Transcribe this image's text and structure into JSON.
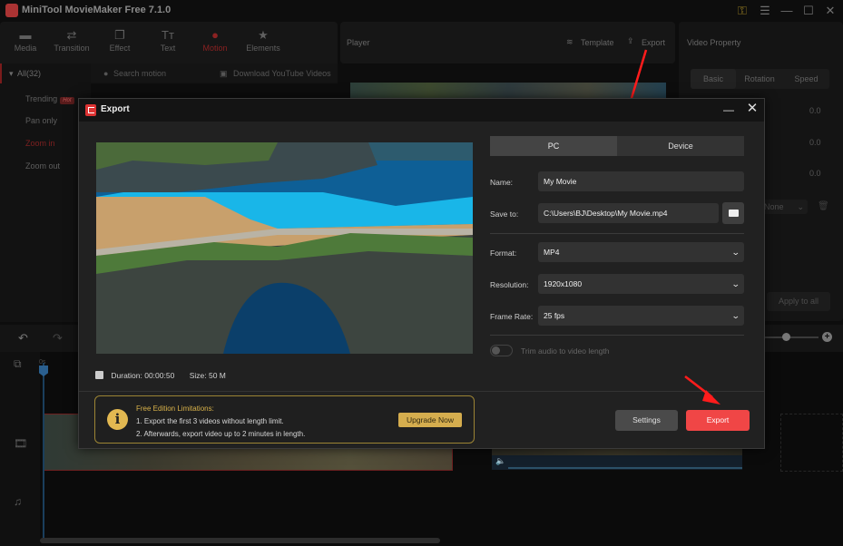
{
  "app": {
    "title": "MiniTool MovieMaker Free 7.1.0",
    "window_controls": [
      "key-icon",
      "menu-icon",
      "minimize-icon",
      "maximize-icon",
      "close-icon"
    ]
  },
  "toolbar": {
    "tabs": [
      {
        "label": "Media",
        "icon": "folder-icon",
        "active": false
      },
      {
        "label": "Transition",
        "icon": "swap-icon",
        "active": false
      },
      {
        "label": "Effect",
        "icon": "layers-icon",
        "active": false
      },
      {
        "label": "Text",
        "icon": "text-icon",
        "active": false
      },
      {
        "label": "Motion",
        "icon": "motion-icon",
        "active": true
      },
      {
        "label": "Elements",
        "icon": "elements-icon",
        "active": false
      }
    ]
  },
  "library": {
    "category_all": "All(32)",
    "search_placeholder": "Search motion",
    "download_label": "Download YouTube Videos",
    "items": [
      {
        "label": "Trending",
        "badge": "Hot",
        "active": false
      },
      {
        "label": "Pan only",
        "active": false
      },
      {
        "label": "Zoom in",
        "active": true
      },
      {
        "label": "Zoom out",
        "active": false
      }
    ]
  },
  "player": {
    "title": "Player",
    "template_label": "Template",
    "export_label": "Export"
  },
  "property": {
    "title": "Video Property",
    "tabs": [
      {
        "label": "Basic",
        "active": true
      },
      {
        "label": "Rotation",
        "active": false
      },
      {
        "label": "Speed",
        "active": false
      }
    ],
    "values": [
      "0.0",
      "0.0",
      "0.0"
    ],
    "select_value": "None",
    "apply_all_label": "Apply to all"
  },
  "timeline": {
    "time_zero": "0s",
    "zoom_level": 0.4
  },
  "dialog": {
    "title": "Export",
    "tabs": [
      {
        "label": "PC",
        "active": true
      },
      {
        "label": "Device",
        "active": false
      }
    ],
    "fields": {
      "name_label": "Name:",
      "name_value": "My Movie",
      "save_label": "Save to:",
      "save_value": "C:\\Users\\BJ\\Desktop\\My Movie.mp4",
      "format_label": "Format:",
      "format_value": "MP4",
      "resolution_label": "Resolution:",
      "resolution_value": "1920x1080",
      "framerate_label": "Frame Rate:",
      "framerate_value": "25 fps"
    },
    "trim_audio_label": "Trim audio to video length",
    "trim_audio_on": false,
    "duration": "Duration:  00:00:50",
    "size": "Size: 50 M",
    "limits": {
      "title": "Free Edition Limitations:",
      "line1": "1. Export the first 3 videos without length limit.",
      "line2": "2. Afterwards, export video up to 2 minutes in length.",
      "upgrade_label": "Upgrade Now"
    },
    "settings_label": "Settings",
    "export_label": "Export"
  },
  "colors": {
    "accent_red": "#f04646",
    "gold": "#d5ad4e",
    "motion_active": "#8b2222"
  }
}
